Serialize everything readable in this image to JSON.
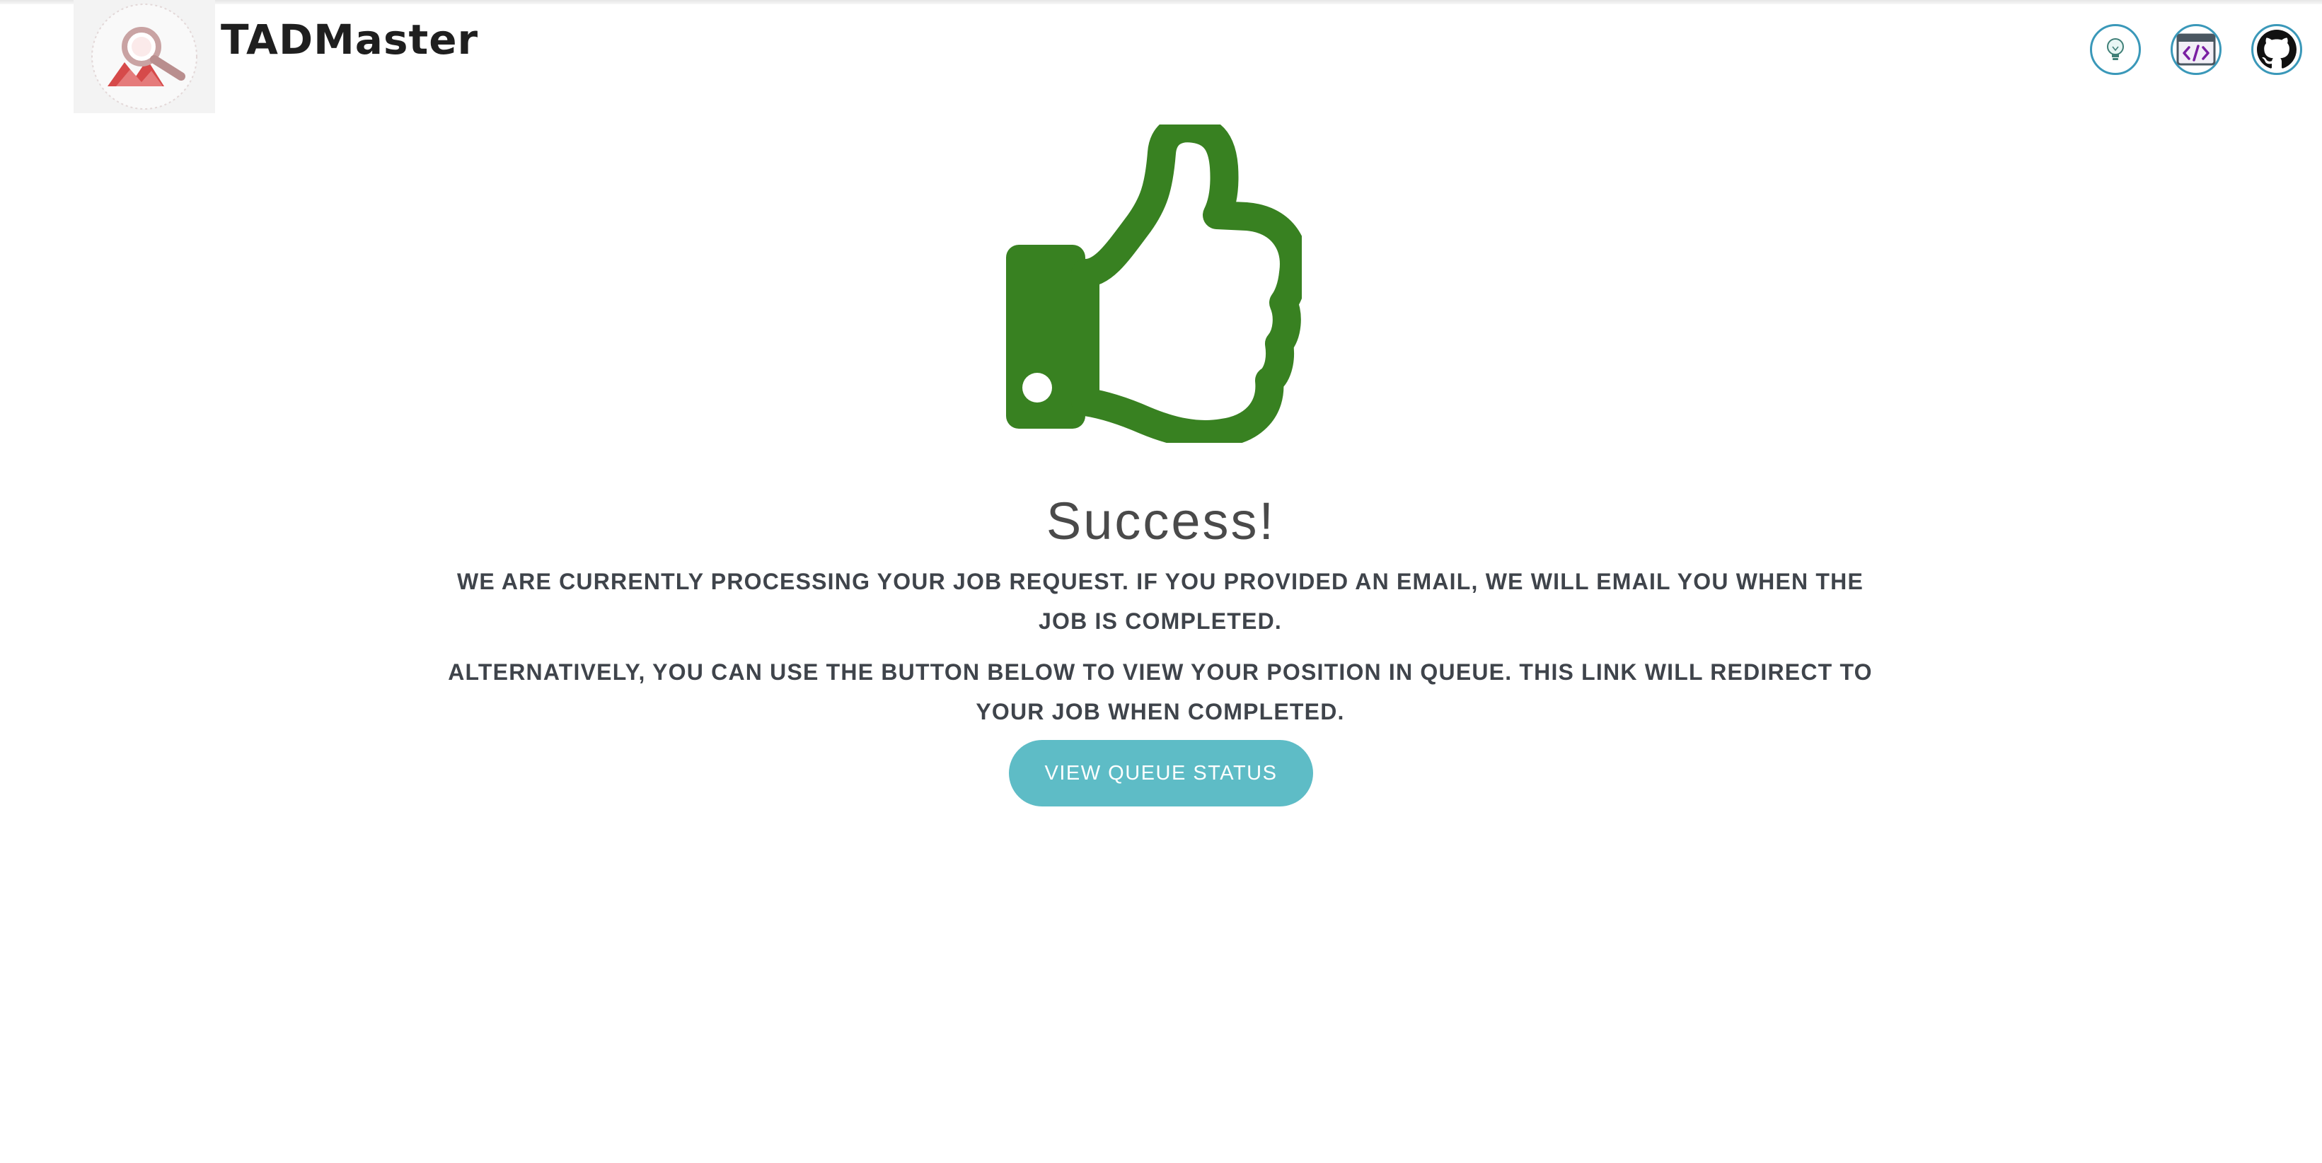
{
  "header": {
    "brand": "TADMaster",
    "icons": [
      "idea-icon",
      "code-icon",
      "github-icon"
    ]
  },
  "main": {
    "icon": "thumbs-up-icon",
    "title": "Success!",
    "message_1": "WE ARE CURRENTLY PROCESSING YOUR JOB REQUEST. IF YOU PROVIDED AN EMAIL, WE WILL EMAIL YOU WHEN THE JOB IS COMPLETED.",
    "message_2": "ALTERNATIVELY, YOU CAN USE THE BUTTON BELOW TO VIEW YOUR POSITION IN QUEUE. THIS LINK WILL REDIRECT TO YOUR JOB WHEN COMPLETED.",
    "button_label": "VIEW QUEUE STATUS"
  },
  "colors": {
    "thumb_green": "#388121",
    "button_teal": "#5ebcc6",
    "icon_border": "#3a98b9",
    "text_dark": "#3f444b"
  }
}
